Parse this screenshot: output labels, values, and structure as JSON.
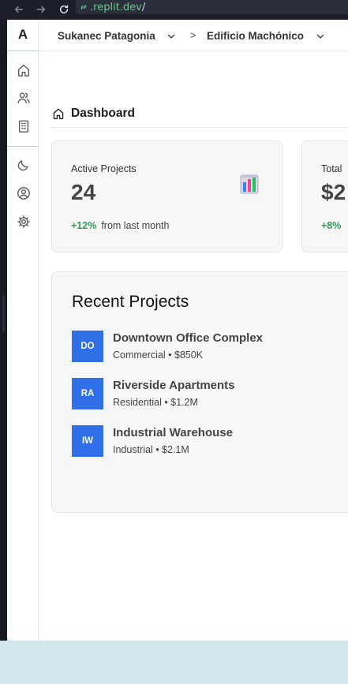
{
  "browser": {
    "url_text": ".replit.dev",
    "url_suffix": "/"
  },
  "sidebar": {
    "logo": "A",
    "items": [
      {
        "icon": "home-icon"
      },
      {
        "icon": "users-icon"
      },
      {
        "icon": "building-icon"
      },
      {
        "icon": "moon-icon"
      },
      {
        "icon": "profile-icon"
      },
      {
        "icon": "settings-icon"
      }
    ]
  },
  "topbar": {
    "workspace": "Sukanec Patagonia",
    "separator": ">",
    "project": "Edificio Machónico"
  },
  "page": {
    "title": "Dashboard"
  },
  "stats": [
    {
      "label": "Active Projects",
      "value": "24",
      "change": "+12%",
      "note": "from last month",
      "icon": "bar-chart-icon"
    },
    {
      "label": "Total",
      "value": "$2",
      "change": "+8%",
      "note": ""
    }
  ],
  "recent": {
    "title": "Recent Projects",
    "projects": [
      {
        "initials": "DO",
        "name": "Downtown Office Complex",
        "meta": "Commercial • $850K"
      },
      {
        "initials": "RA",
        "name": "Riverside Apartments",
        "meta": "Residential • $1.2M"
      },
      {
        "initials": "IW",
        "name": "Industrial Warehouse",
        "meta": "Industrial • $2.1M"
      }
    ]
  },
  "colors": {
    "accent": "#2f6fe8",
    "positive": "#2e9c57",
    "url": "#6fc38d",
    "browser_bg": "#1c1f2a",
    "desktop_bg": "#d3e6ee"
  }
}
